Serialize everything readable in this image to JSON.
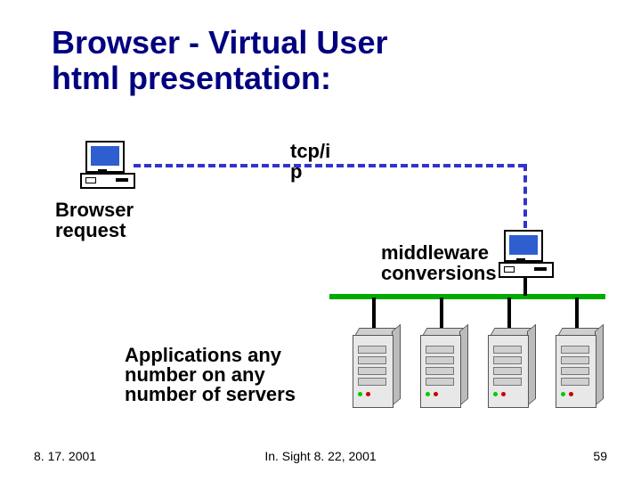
{
  "title_line1": "Browser - Virtual User",
  "title_line2": "html presentation:",
  "labels": {
    "tcpip": "tcp/i\np",
    "browser_request": "Browser request",
    "middleware": "middleware conversions",
    "applications": "Applications any number on any number of servers"
  },
  "footer": {
    "left": "8. 17. 2001",
    "center": "In. Sight 8. 22, 2001",
    "right": "59"
  },
  "colors": {
    "title": "#000080",
    "dash": "#3333cc",
    "net": "#00aa00"
  }
}
